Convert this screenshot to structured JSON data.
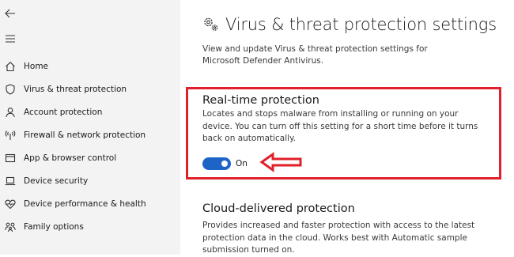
{
  "nav": {
    "back_icon": "back-arrow-icon",
    "menu_icon": "hamburger-menu-icon",
    "items": [
      {
        "label": "Home",
        "icon": "home-icon"
      },
      {
        "label": "Virus & threat protection",
        "icon": "shield-icon"
      },
      {
        "label": "Account protection",
        "icon": "person-icon"
      },
      {
        "label": "Firewall & network protection",
        "icon": "wireless-icon"
      },
      {
        "label": "App & browser control",
        "icon": "browser-window-icon"
      },
      {
        "label": "Device security",
        "icon": "laptop-icon"
      },
      {
        "label": "Device performance & health",
        "icon": "heart-icon"
      },
      {
        "label": "Family options",
        "icon": "family-icon"
      }
    ]
  },
  "main": {
    "title_icon": "gears-icon",
    "title": "Virus & threat protection settings",
    "description": "View and update Virus & threat protection settings for Microsoft Defender Antivirus.",
    "realtime": {
      "title": "Real-time protection",
      "description": "Locates and stops malware from installing or running on your device. You can turn off this setting for a short time before it turns back on automatically.",
      "toggle_state": "On",
      "toggle_on": true
    },
    "cloud": {
      "title": "Cloud-delivered protection",
      "description": "Provides increased and faster protection with access to the latest protection data in the cloud. Works best with Automatic sample submission turned on."
    }
  },
  "colors": {
    "sidebar_bg": "#f3f3f3",
    "toggle_on": "#1e63c6",
    "annotation_red": "#e0202a"
  }
}
